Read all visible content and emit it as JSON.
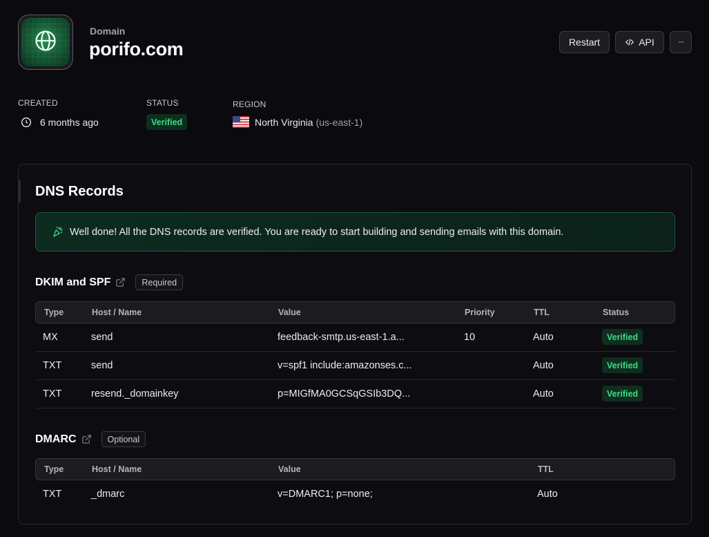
{
  "header": {
    "eyebrow": "Domain",
    "title": "porifo.com",
    "buttons": {
      "restart": "Restart",
      "api": "API",
      "more": "···"
    }
  },
  "meta": {
    "created_label": "CREATED",
    "created_value": "6 months ago",
    "status_label": "STATUS",
    "status_value": "Verified",
    "region_label": "REGION",
    "region_name": "North Virginia",
    "region_code": "(us-east-1)"
  },
  "dns": {
    "title": "DNS Records",
    "banner": "Well done! All the DNS records are verified. You are ready to start building and sending emails with this domain.",
    "dkim": {
      "title": "DKIM and SPF",
      "tag": "Required",
      "columns": [
        "Type",
        "Host / Name",
        "Value",
        "Priority",
        "TTL",
        "Status"
      ],
      "rows": [
        [
          "MX",
          "send",
          "feedback-smtp.us-east-1.a...",
          "10",
          "Auto",
          "Verified"
        ],
        [
          "TXT",
          "send",
          "v=spf1 include:amazonses.c...",
          "",
          "Auto",
          "Verified"
        ],
        [
          "TXT",
          "resend._domainkey",
          "p=MIGfMA0GCSqGSIb3DQ...",
          "",
          "Auto",
          "Verified"
        ]
      ]
    },
    "dmarc": {
      "title": "DMARC",
      "tag": "Optional",
      "columns": [
        "Type",
        "Host / Name",
        "Value",
        "TTL"
      ],
      "rows": [
        [
          "TXT",
          "_dmarc",
          "v=DMARC1; p=none;",
          "Auto"
        ]
      ]
    }
  },
  "colors": {
    "background": "#0a0a0f",
    "accent_green": "#3ddc84",
    "banner_border": "#1d5b3d"
  },
  "icons": {
    "logo": "globe-icon",
    "api": "code-icon",
    "created": "clock-icon",
    "region": "us-flag-icon",
    "banner": "party-popper-icon",
    "external": "external-link-icon"
  }
}
